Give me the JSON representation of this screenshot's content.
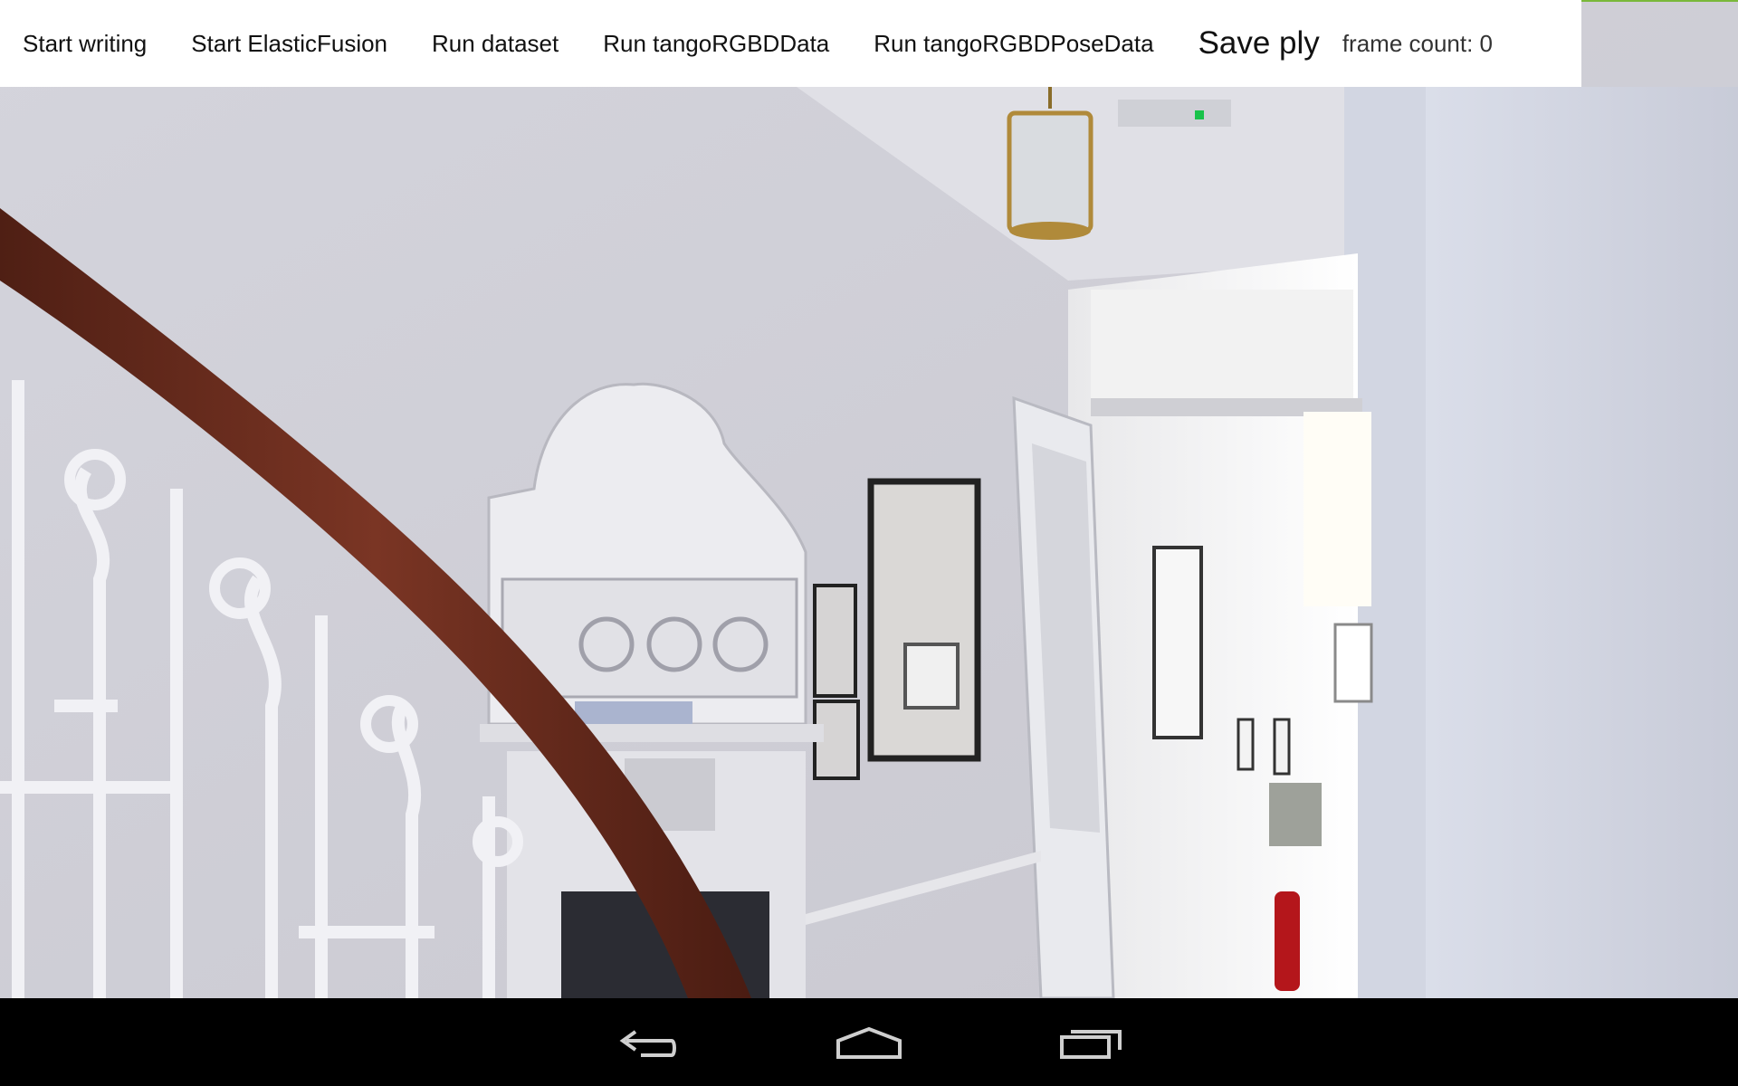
{
  "toolbar": {
    "start_writing": "Start writing",
    "start_elasticfusion": "Start ElasticFusion",
    "run_dataset": "Run dataset",
    "run_tango_rgbd": "Run tangoRGBDData",
    "run_tango_rgbd_pose": "Run tangoRGBDPoseData",
    "save_ply": "Save ply",
    "frame_count": "frame count: 0"
  },
  "camera": {
    "icon": "camera-feed-image"
  },
  "navbar": {
    "icons": [
      "back-icon",
      "home-icon",
      "recent-apps-icon"
    ]
  },
  "colors": {
    "toolbar_bg": "#ffffff",
    "nav_bg": "#000000",
    "accent": "#7ab83a",
    "handrail": "#6b2d1f"
  }
}
